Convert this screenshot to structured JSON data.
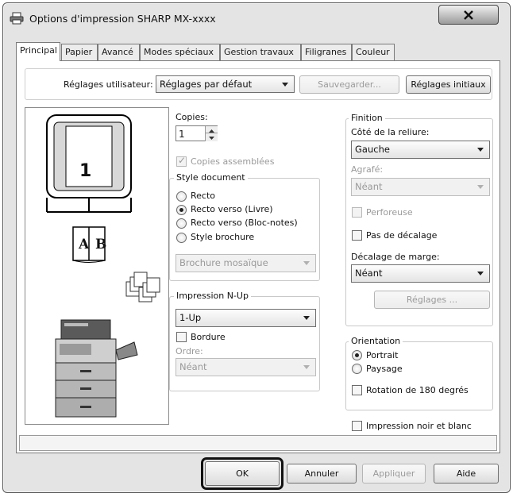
{
  "window": {
    "title": "Options d'impression SHARP MX-xxxx"
  },
  "tabs": [
    "Principal",
    "Papier",
    "Avancé",
    "Modes spéciaux",
    "Gestion travaux",
    "Filigranes",
    "Couleur"
  ],
  "user_settings": {
    "label": "Réglages utilisateur:",
    "value": "Réglages par défaut",
    "save_label": "Sauvegarder...",
    "reset_label": "Réglages initiaux"
  },
  "preview": {
    "page_number": "1",
    "book_left": "A",
    "book_right": "B"
  },
  "copies": {
    "label": "Copies:",
    "value": "1",
    "collate_label": "Copies assemblées"
  },
  "document_style": {
    "legend": "Style document",
    "options": [
      "Recto",
      "Recto verso (Livre)",
      "Recto verso (Bloc-notes)",
      "Style brochure"
    ],
    "selected_index": 1,
    "brochure_value": "Brochure mosaïque"
  },
  "nup": {
    "legend": "Impression N-Up",
    "value": "1-Up",
    "border_label": "Bordure",
    "order_label": "Ordre:",
    "order_value": "Néant"
  },
  "finishing": {
    "legend": "Finition",
    "binding_label": "Côté de la reliure:",
    "binding_value": "Gauche",
    "staple_label": "Agrafé:",
    "staple_value": "Néant",
    "punch_label": "Perforeuse",
    "no_offset_label": "Pas de décalage",
    "margin_label": "Décalage de marge:",
    "margin_value": "Néant",
    "settings_label": "Réglages ..."
  },
  "orientation": {
    "legend": "Orientation",
    "options": [
      "Portrait",
      "Paysage"
    ],
    "selected_index": 0,
    "rotate_label": "Rotation de 180 degrés"
  },
  "bw_label": "Impression noir et blanc",
  "buttons": {
    "ok": "OK",
    "cancel": "Annuler",
    "apply": "Appliquer",
    "help": "Aide"
  }
}
